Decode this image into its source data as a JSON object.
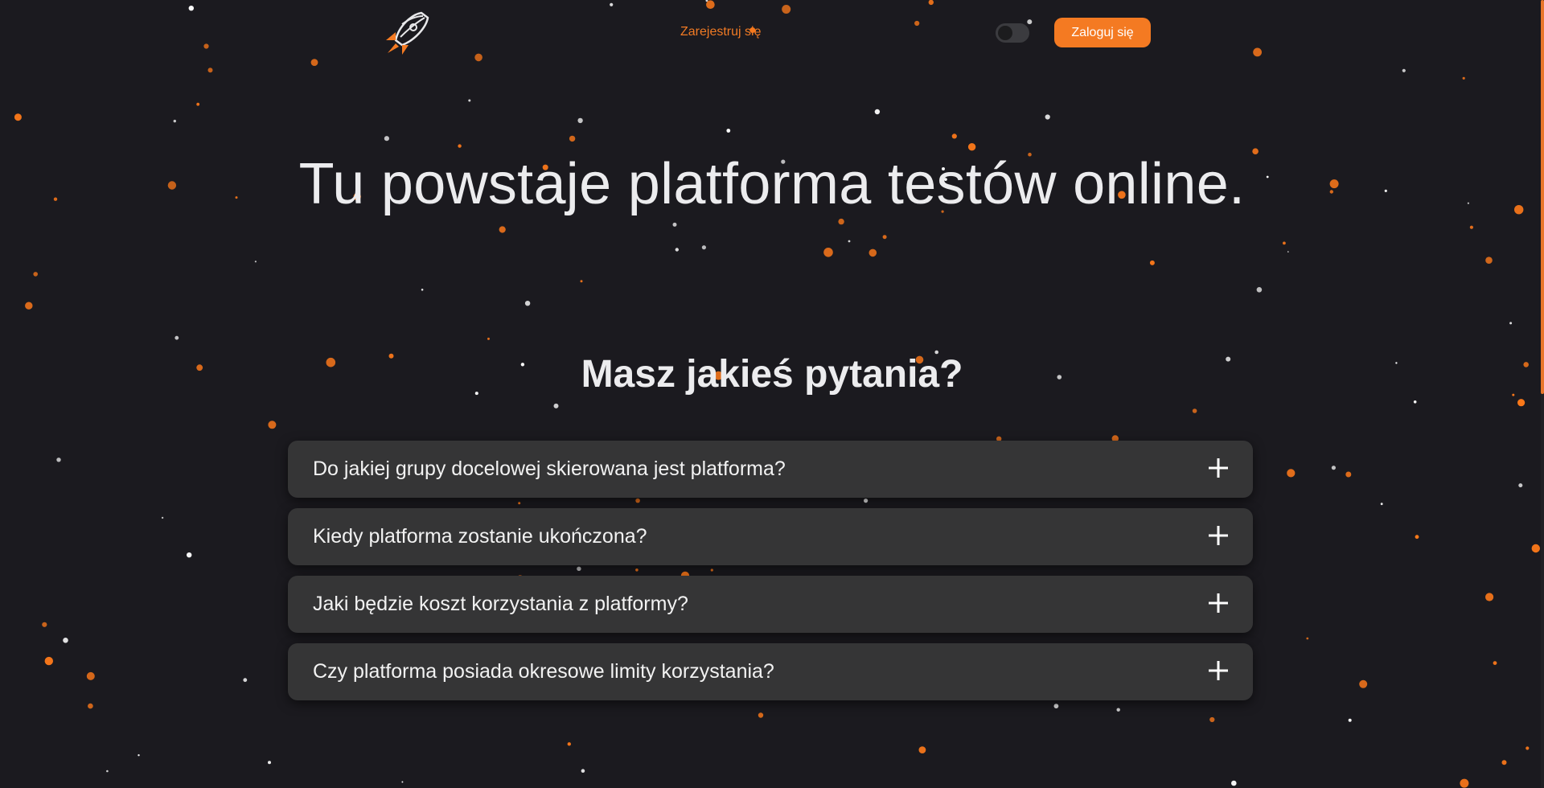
{
  "header": {
    "logo_icon": "rocket-icon",
    "register_label": "Zarejestruj się",
    "theme_toggle_icon": "theme-toggle-switch",
    "login_label": "Zaloguj się"
  },
  "hero": {
    "title": "Tu powstaje platforma testów online."
  },
  "faq": {
    "heading": "Masz jakieś pytania?",
    "expand_icon": "plus-icon",
    "items": [
      {
        "question": "Do jakiej grupy docelowej skierowana jest platforma?"
      },
      {
        "question": "Kiedy platforma zostanie ukończona?"
      },
      {
        "question": "Jaki będzie koszt korzystania z platformy?"
      },
      {
        "question": "Czy platforma posiada okresowe limity korzystania?"
      }
    ]
  },
  "colors": {
    "background": "#1b1a1f",
    "accent": "#f47a22",
    "card": "#353536",
    "text": "#ececee",
    "star_orange": "#ff7a1a",
    "star_white": "#ffffff"
  }
}
